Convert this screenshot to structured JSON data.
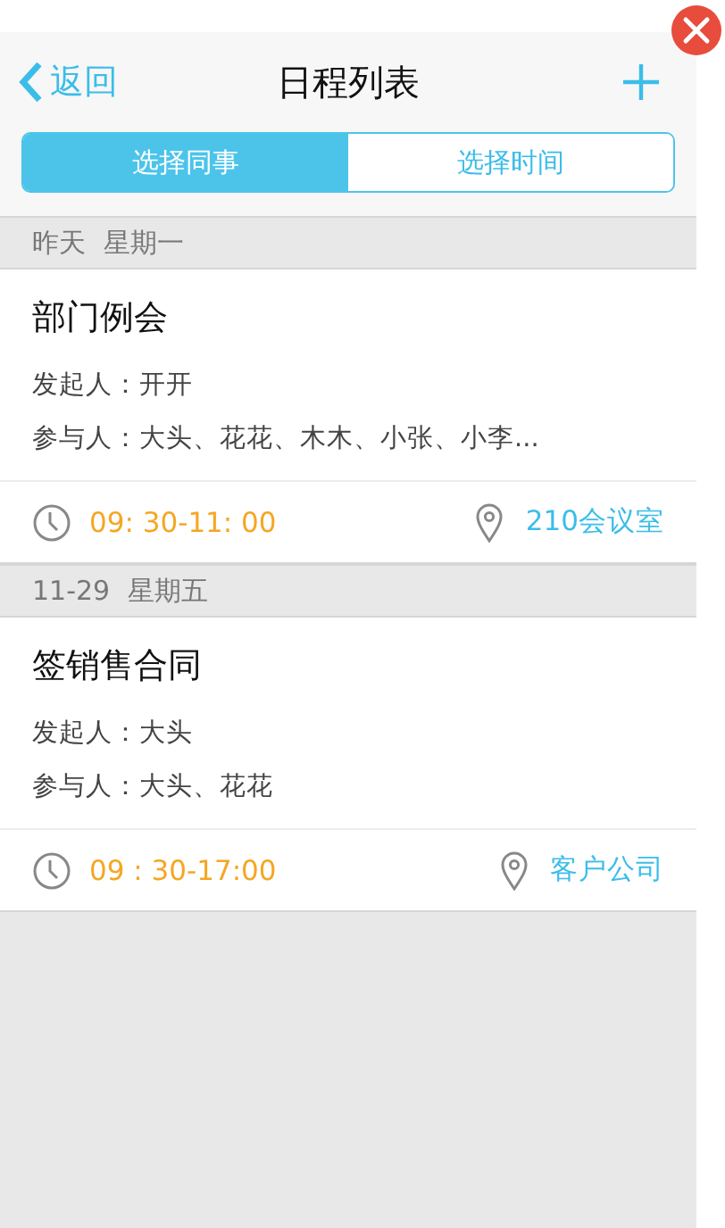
{
  "header": {
    "back": "返回",
    "title": "日程列表"
  },
  "tabs": [
    {
      "label": "选择同事",
      "selected": true
    },
    {
      "label": "选择时间",
      "selected": false
    }
  ],
  "days": [
    {
      "date": "昨天",
      "weekday": "星期一",
      "events": [
        {
          "title": "部门例会",
          "organizer": "发起人：开开",
          "participants": "参与人：大头、花花、木木、小张、小李...",
          "time": "09: 30-11: 00",
          "location": "210会议室"
        }
      ]
    },
    {
      "date": "11-29",
      "weekday": "星期五",
      "events": [
        {
          "title": "签销售合同",
          "organizer": "发起人：大头",
          "participants": "参与人：大头、花花",
          "time": "09 : 30-17:00",
          "location": "客户公司"
        }
      ]
    }
  ]
}
